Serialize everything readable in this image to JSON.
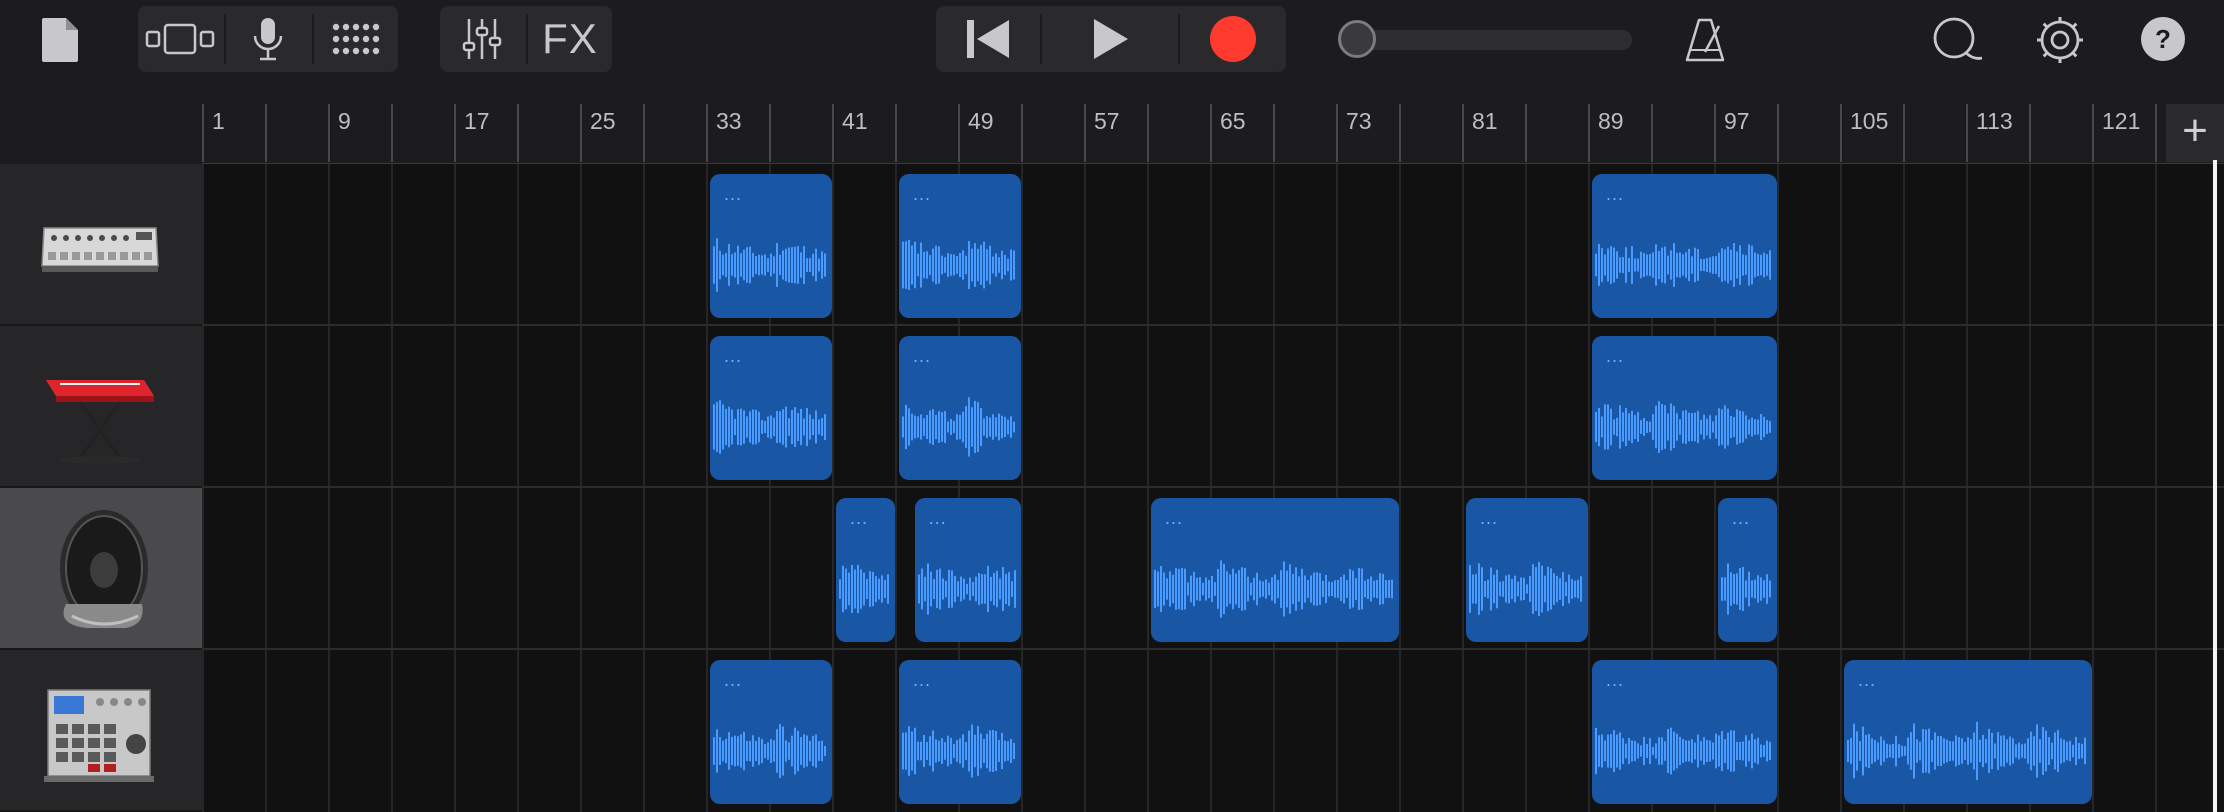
{
  "toolbar": {
    "fx_label": "FX",
    "icons": [
      "document-icon",
      "track-view-icon",
      "microphone-icon",
      "grid-icon",
      "mixer-icon",
      "rewind-icon",
      "play-icon",
      "record-icon",
      "metronome-icon",
      "loop-icon",
      "settings-icon",
      "help-icon"
    ]
  },
  "colors": {
    "background": "#1c1c1e",
    "region": "#1957a5",
    "waveform": "#4a9bff",
    "record": "#ff3b30",
    "playhead": "#f2f2f2"
  },
  "ruler": {
    "labels": [
      "1",
      "9",
      "17",
      "25",
      "33",
      "41",
      "49",
      "57",
      "65",
      "73",
      "81",
      "89",
      "97",
      "105",
      "113",
      "121"
    ],
    "add_label": "+"
  },
  "tracks": [
    {
      "instrument": "drum-machine",
      "selected": false,
      "regions": [
        {
          "start": 33,
          "bars": 8,
          "label": "..."
        },
        {
          "start": 45,
          "bars": 8,
          "label": "..."
        },
        {
          "start": 89,
          "bars": 12,
          "label": "..."
        }
      ]
    },
    {
      "instrument": "keyboard",
      "selected": false,
      "regions": [
        {
          "start": 33,
          "bars": 8,
          "label": "..."
        },
        {
          "start": 45,
          "bars": 8,
          "label": "..."
        },
        {
          "start": 89,
          "bars": 12,
          "label": "..."
        }
      ]
    },
    {
      "instrument": "audio-speaker",
      "selected": true,
      "regions": [
        {
          "start": 41,
          "bars": 4,
          "label": "..."
        },
        {
          "start": 46,
          "bars": 7,
          "label": "..."
        },
        {
          "start": 61,
          "bars": 16,
          "label": "..."
        },
        {
          "start": 81,
          "bars": 8,
          "label": "..."
        },
        {
          "start": 97,
          "bars": 4,
          "label": "..."
        }
      ]
    },
    {
      "instrument": "beat-sampler",
      "selected": false,
      "regions": [
        {
          "start": 33,
          "bars": 8,
          "label": "..."
        },
        {
          "start": 45,
          "bars": 8,
          "label": "..."
        },
        {
          "start": 89,
          "bars": 12,
          "label": "..."
        },
        {
          "start": 105,
          "bars": 16,
          "label": "..."
        }
      ]
    }
  ]
}
